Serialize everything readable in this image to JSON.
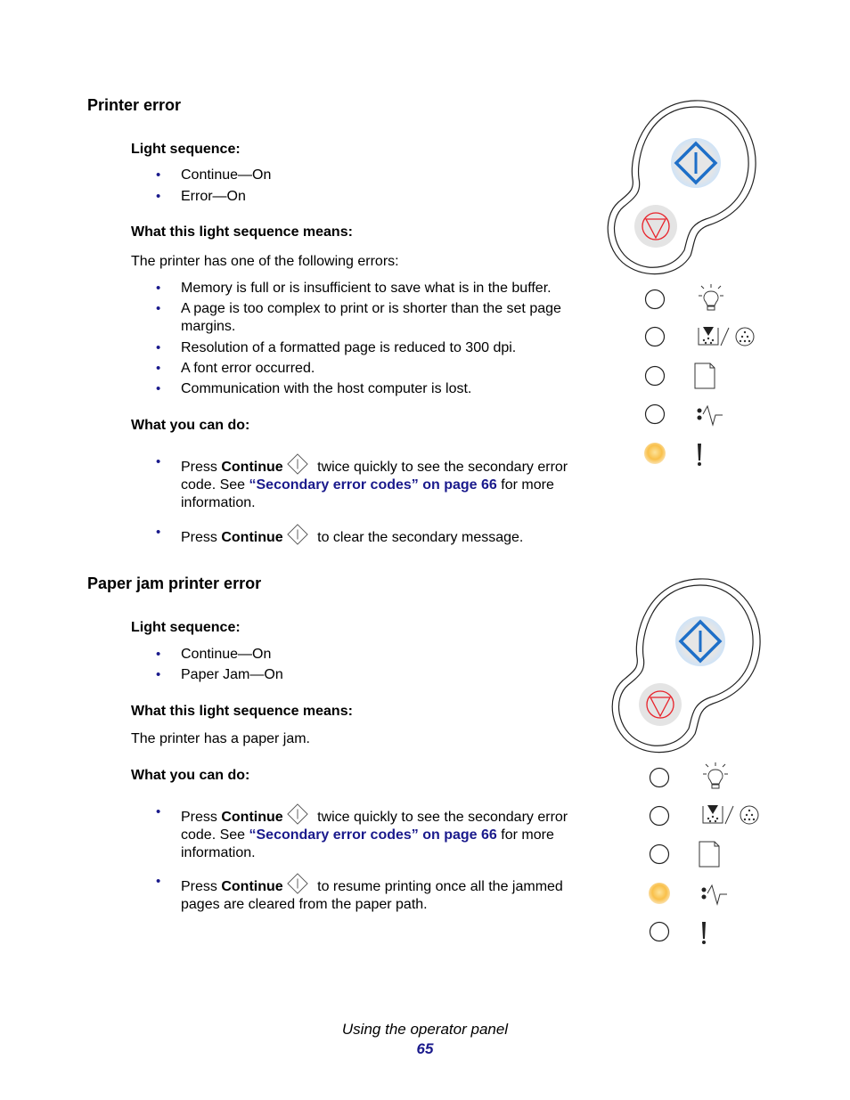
{
  "sections": [
    {
      "title": "Printer error",
      "light_sequence_heading": "Light sequence:",
      "light_sequence": [
        "Continue—On",
        "Error—On"
      ],
      "means_heading": "What this light sequence means:",
      "means_text": "The printer has one of the following errors:",
      "means_list": [
        "Memory is full or is insufficient to save what is in the buffer.",
        "A page is too complex to print or is shorter than the set page margins.",
        "Resolution of a formatted page is reduced to 300 dpi.",
        "A font error occurred.",
        "Communication with the host computer is lost."
      ],
      "do_heading": "What you can do:",
      "actions": [
        {
          "pre": "Press ",
          "bold": "Continue",
          "post": " twice quickly to see the secondary error code. See ",
          "link": "“Secondary error codes” on page 66",
          "tail": " for more information."
        },
        {
          "pre": "Press ",
          "bold": "Continue",
          "post": " to clear the secondary message."
        }
      ],
      "panel": {
        "continue_button": "lit",
        "stop_button": "lit",
        "lights": [
          {
            "icon": "ready-lightbulb-icon",
            "state": "off"
          },
          {
            "icon": "toner-low-icon",
            "state": "off"
          },
          {
            "icon": "load-paper-icon",
            "state": "off"
          },
          {
            "icon": "paper-jam-icon",
            "state": "off"
          },
          {
            "icon": "error-exclamation-icon",
            "state": "on"
          }
        ]
      }
    },
    {
      "title": "Paper jam printer error",
      "light_sequence_heading": "Light sequence:",
      "light_sequence": [
        "Continue—On",
        "Paper Jam—On"
      ],
      "means_heading": "What this light sequence means:",
      "means_text": "The printer has a paper jam.",
      "do_heading": "What you can do:",
      "actions": [
        {
          "pre": "Press ",
          "bold": "Continue",
          "post": " twice quickly to see the secondary error code. See ",
          "link": "“Secondary error codes” on page 66",
          "tail": " for more information."
        },
        {
          "pre": "Press ",
          "bold": "Continue",
          "post": " to resume printing once all the jammed pages are cleared from the paper path."
        }
      ],
      "panel": {
        "continue_button": "lit",
        "stop_button": "lit",
        "lights": [
          {
            "icon": "ready-lightbulb-icon",
            "state": "off"
          },
          {
            "icon": "toner-low-icon",
            "state": "off"
          },
          {
            "icon": "load-paper-icon",
            "state": "off"
          },
          {
            "icon": "paper-jam-icon",
            "state": "on"
          },
          {
            "icon": "error-exclamation-icon",
            "state": "off"
          }
        ]
      }
    }
  ],
  "footer": {
    "title": "Using the operator panel",
    "page_number": "65"
  },
  "colors": {
    "link": "#1a1a8c",
    "continue_blue": "#1e6fc8",
    "stop_red": "#e8222a",
    "light_on": "#f9c04a"
  }
}
